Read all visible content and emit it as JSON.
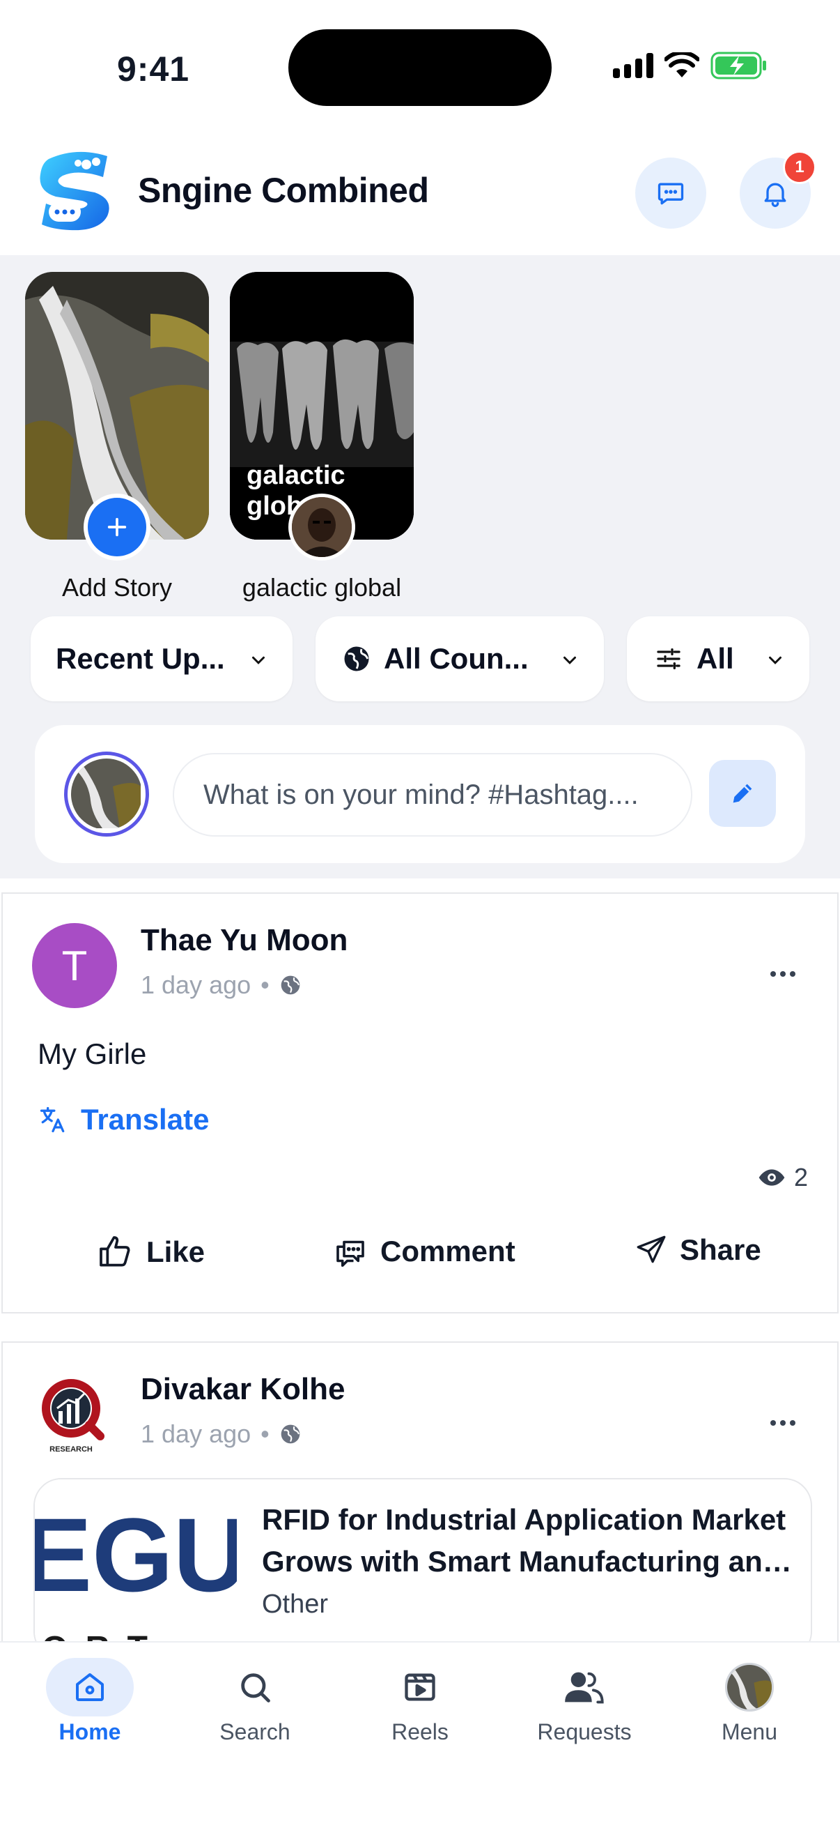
{
  "status": {
    "time": "9:41"
  },
  "header": {
    "title": "Sngine Combined",
    "notification_count": "1"
  },
  "stories": [
    {
      "label": "Add Story"
    },
    {
      "label": "galactic global",
      "overlay": "galactic global"
    }
  ],
  "filters": {
    "sort": "Recent Up...",
    "country": "All Coun...",
    "type": "All"
  },
  "composer": {
    "placeholder": "What is on your mind? #Hashtag...."
  },
  "posts": [
    {
      "author": "Thae Yu Moon",
      "avatar_letter": "T",
      "time": "1 day ago",
      "text": "My Girle",
      "translate": "Translate",
      "views": "2",
      "actions": {
        "like": "Like",
        "comment": "Comment",
        "share": "Share"
      }
    },
    {
      "author": "Divakar Kolhe",
      "time": "1 day ago",
      "link": {
        "title_line1": "RFID for Industrial Application Market",
        "title_line2": "Grows with Smart Manufacturing and...",
        "category": "Other",
        "thumb_text_top": "EGU",
        "thumb_text_bottom": "O R T"
      },
      "avatar_caption": "RESEARCH"
    }
  ],
  "tabs": [
    {
      "label": "Home"
    },
    {
      "label": "Search"
    },
    {
      "label": "Reels"
    },
    {
      "label": "Requests"
    },
    {
      "label": "Menu"
    }
  ],
  "colors": {
    "accent": "#1a6ff3",
    "badge": "#f04438",
    "avatar_t": "#a84dc5",
    "band": "#f1f2f6"
  },
  "icons": [
    "signal-icon",
    "wifi-icon",
    "battery-charging-icon",
    "chat-icon",
    "bell-icon",
    "plus-icon",
    "chevron-down-icon",
    "globe-icon",
    "sliders-icon",
    "pencil-icon",
    "more-icon",
    "translate-icon",
    "eye-icon",
    "like-icon",
    "comment-icon",
    "share-icon",
    "home-icon",
    "search-icon",
    "reels-icon",
    "requests-icon"
  ]
}
